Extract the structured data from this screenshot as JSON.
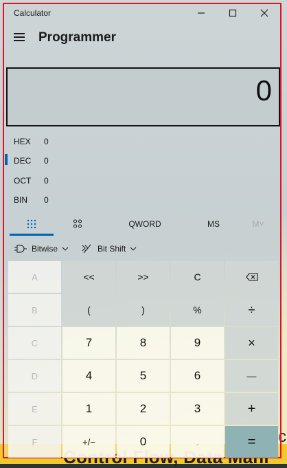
{
  "window": {
    "title": "Calculator",
    "minimize_label": "—",
    "maximize_label": "☐",
    "close_label": "✕"
  },
  "header": {
    "mode": "Programmer"
  },
  "display": {
    "value": "0"
  },
  "radix": [
    {
      "label": "HEX",
      "value": "0"
    },
    {
      "label": "DEC",
      "value": "0"
    },
    {
      "label": "OCT",
      "value": "0"
    },
    {
      "label": "BIN",
      "value": "0"
    }
  ],
  "toolbar": {
    "word_size": "QWORD",
    "ms": "MS",
    "m_dropdown": "M˅"
  },
  "subbar": {
    "bitwise": "Bitwise",
    "bitshift": "Bit Shift"
  },
  "keys": {
    "A": "A",
    "lshift": "<<",
    "rshift": ">>",
    "clear": "C",
    "backspace": "⌫",
    "B": "B",
    "lparen": "(",
    "rparen": ")",
    "percent": "%",
    "divide": "÷",
    "C": "C",
    "seven": "7",
    "eight": "8",
    "nine": "9",
    "multiply": "×",
    "D": "D",
    "four": "4",
    "five": "5",
    "six": "6",
    "minus": "—",
    "E": "E",
    "one": "1",
    "two": "2",
    "three": "3",
    "plus": "+",
    "F": "F",
    "negate": "+/−",
    "zero": "0",
    "dot": ".",
    "equals": "="
  },
  "background": {
    "text": "Control Flow, Data Mani",
    "letter": "c"
  }
}
